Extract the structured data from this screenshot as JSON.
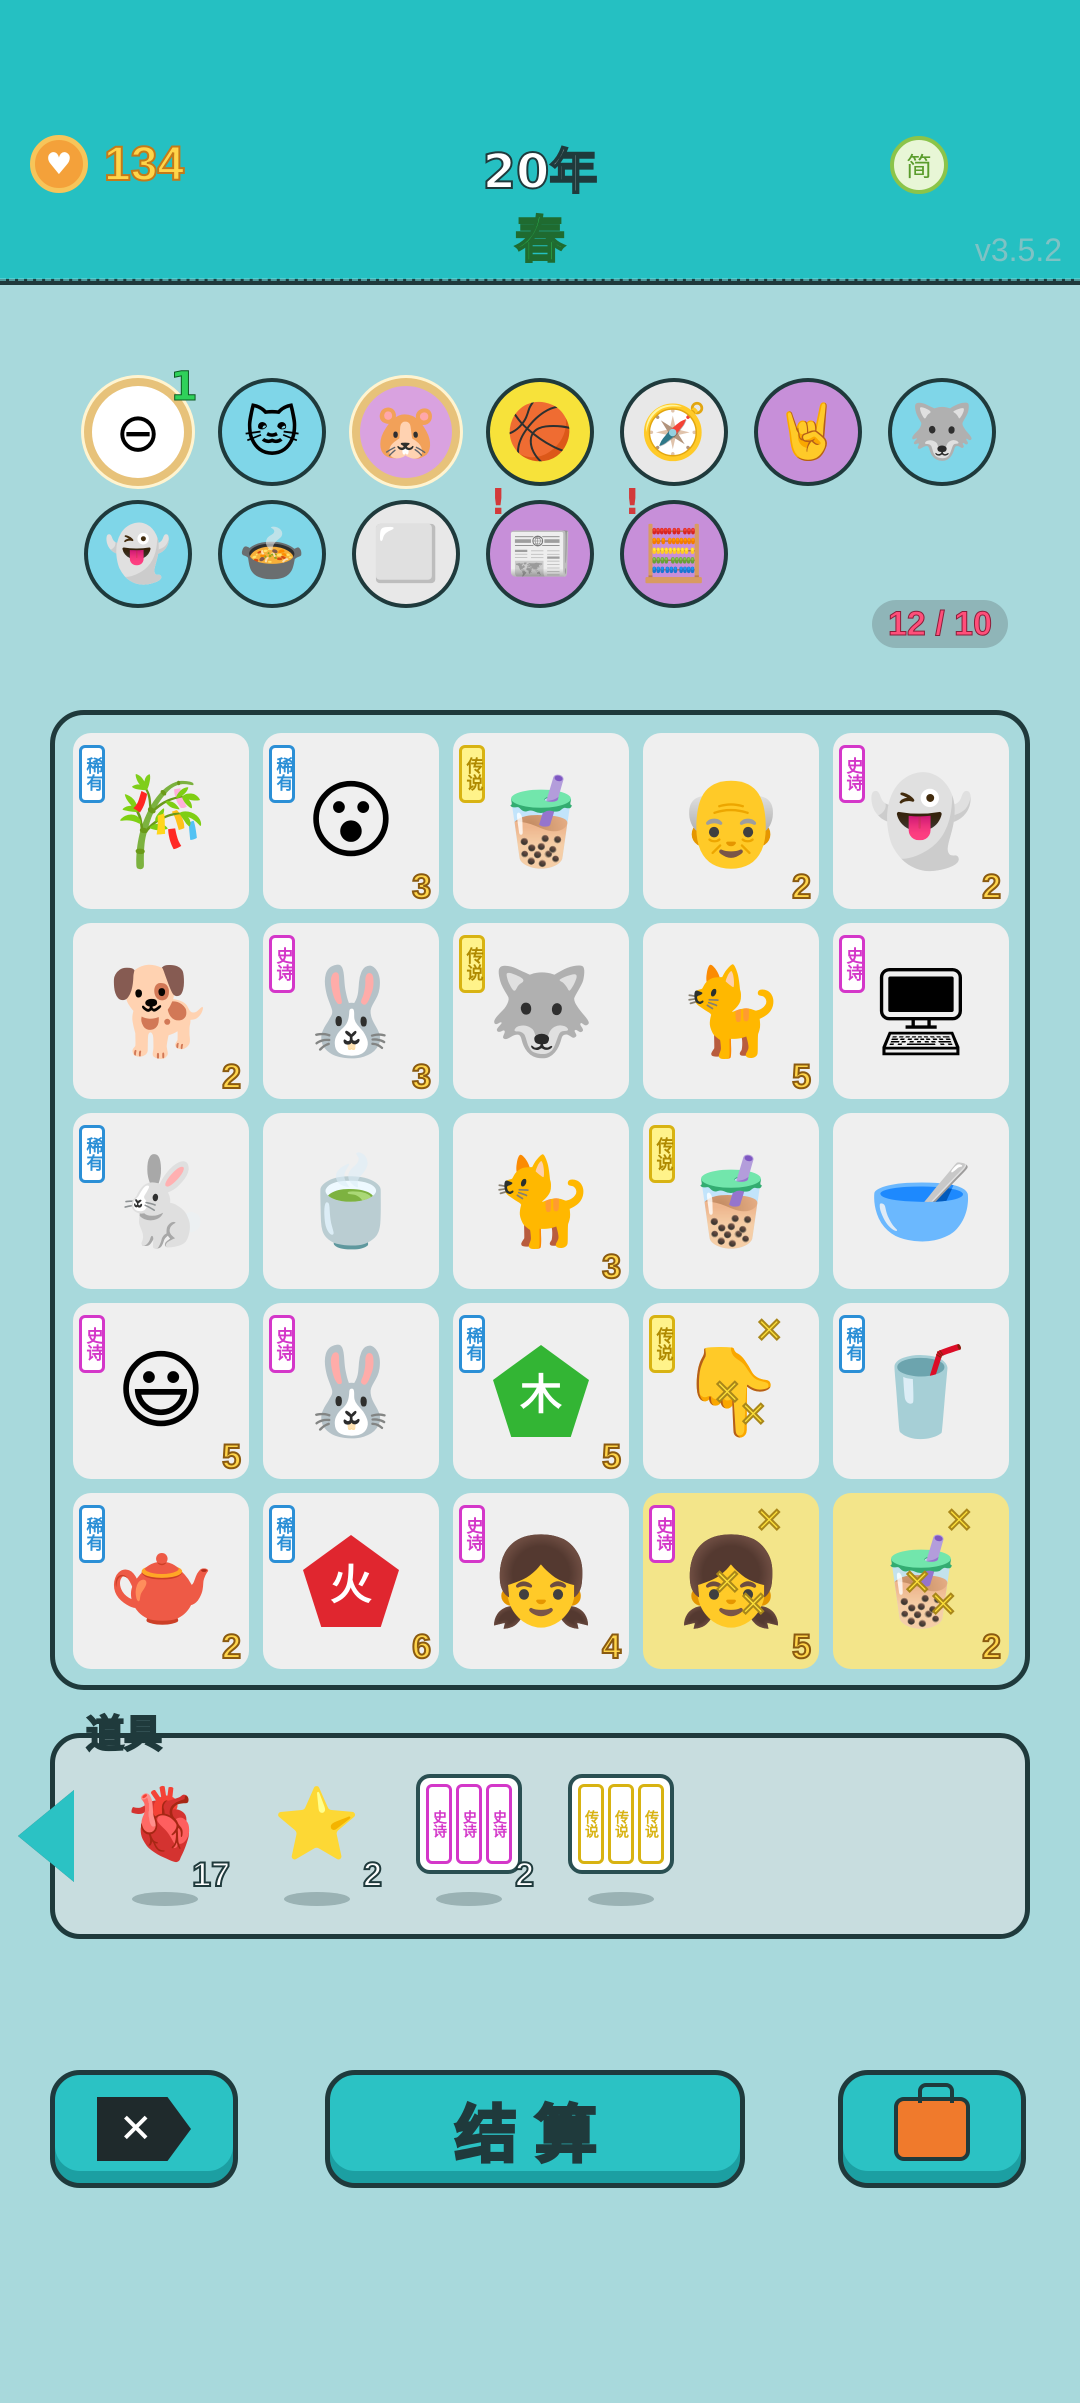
{
  "header": {
    "coins": "134",
    "year": "20年",
    "season": "春",
    "lang_label": "简",
    "version": "v3.5.2"
  },
  "relics": [
    {
      "icon": "⊖",
      "icon_name": "minus-ring-icon",
      "badge": "1",
      "gold": true,
      "bg": "#ffffff"
    },
    {
      "icon": "🐱",
      "icon_name": "cat-in-frame-icon",
      "bg": "#7fd6e8"
    },
    {
      "icon": "🐹",
      "icon_name": "hamsters-icon",
      "gold": true,
      "bg": "#d9a2e0"
    },
    {
      "icon": "🏀",
      "icon_name": "basketballs-icon",
      "bg": "#f7e23a"
    },
    {
      "icon": "🧭",
      "icon_name": "compass-icon",
      "bg": "#e8e8e8"
    },
    {
      "icon": "🤘",
      "icon_name": "rock-hand-icon",
      "bg": "#c78fd9"
    },
    {
      "icon": "🐺",
      "icon_name": "wolf-icon",
      "bg": "#7fd6e8"
    },
    {
      "icon": "👻",
      "icon_name": "ghost-lantern-icon",
      "bg": "#7fd6e8"
    },
    {
      "icon": "🍲",
      "icon_name": "pot-duck-icon",
      "bg": "#7fd6e8"
    },
    {
      "icon": "⬜",
      "icon_name": "sugar-cubes-icon",
      "bg": "#e8e8e8"
    },
    {
      "icon": "📰",
      "icon_name": "time-magazine-icon",
      "alert": "!",
      "bg": "#c78fd9"
    },
    {
      "icon": "🧮",
      "icon_name": "math-face-icon",
      "alert": "!",
      "bg": "#c78fd9"
    }
  ],
  "counter": "12 / 10",
  "board": [
    {
      "icon": "🎋",
      "name": "bamboo",
      "rarity": "稀有",
      "rtype": "rare",
      "count": ""
    },
    {
      "icon": "😮",
      "name": "boy-face",
      "rarity": "稀有",
      "rtype": "rare",
      "count": "3"
    },
    {
      "icon": "🧋",
      "name": "bubble-tea-lid",
      "rarity": "传说",
      "rtype": "legend",
      "count": ""
    },
    {
      "icon": "👴",
      "name": "old-man",
      "rarity": "",
      "rtype": "",
      "count": "2"
    },
    {
      "icon": "👻",
      "name": "ghost",
      "rarity": "史诗",
      "rtype": "epic",
      "count": "2"
    },
    {
      "icon": "🐕",
      "name": "brown-dog",
      "rarity": "",
      "rtype": "",
      "count": "2"
    },
    {
      "icon": "🐰",
      "name": "rabbit-house",
      "rarity": "史诗",
      "rtype": "epic",
      "count": "3"
    },
    {
      "icon": "🐺",
      "name": "husky-king",
      "rarity": "传说",
      "rtype": "legend",
      "count": ""
    },
    {
      "icon": "🐈",
      "name": "yellow-cat",
      "rarity": "",
      "rtype": "",
      "count": "5"
    },
    {
      "icon": "🖥",
      "name": "graphics-card",
      "rarity": "史诗",
      "rtype": "epic",
      "count": ""
    },
    {
      "icon": "🐇",
      "name": "rabbit",
      "rarity": "稀有",
      "rtype": "rare",
      "count": ""
    },
    {
      "icon": "🍵",
      "name": "tea-bag",
      "rarity": "",
      "rtype": "",
      "count": ""
    },
    {
      "icon": "🐈",
      "name": "yellow-cat",
      "rarity": "",
      "rtype": "",
      "count": "3"
    },
    {
      "icon": "🧋",
      "name": "bubble-tea-lid",
      "rarity": "传说",
      "rtype": "legend",
      "count": ""
    },
    {
      "icon": "🥣",
      "name": "tea-bowl",
      "rarity": "",
      "rtype": "",
      "count": ""
    },
    {
      "icon": "😃",
      "name": "yellow-face",
      "rarity": "史诗",
      "rtype": "epic",
      "count": "5"
    },
    {
      "icon": "🐰",
      "name": "rabbit-house",
      "rarity": "史诗",
      "rtype": "epic",
      "count": ""
    },
    {
      "icon": "🟢",
      "name": "wood-element",
      "rarity": "稀有",
      "rtype": "rare",
      "count": "5",
      "glyph": "木"
    },
    {
      "icon": "👇",
      "name": "yellow-hand",
      "rarity": "传说",
      "rtype": "legend",
      "count": "",
      "x": true
    },
    {
      "icon": "🥤",
      "name": "milk-tea-cup",
      "rarity": "稀有",
      "rtype": "rare",
      "count": ""
    },
    {
      "icon": "🫖",
      "name": "teapot",
      "rarity": "稀有",
      "rtype": "rare",
      "count": "2"
    },
    {
      "icon": "🔴",
      "name": "fire-element",
      "rarity": "稀有",
      "rtype": "rare",
      "count": "6",
      "glyph": "火"
    },
    {
      "icon": "👧",
      "name": "heart-girl",
      "rarity": "史诗",
      "rtype": "epic",
      "count": "4"
    },
    {
      "icon": "👧",
      "name": "heart-girl-active",
      "rarity": "史诗",
      "rtype": "epic",
      "count": "5",
      "hl": true,
      "x": true
    },
    {
      "icon": "🧋",
      "name": "bubble-tea-active",
      "rarity": "",
      "rtype": "",
      "count": "2",
      "hl": true,
      "x": true
    }
  ],
  "items_title": "道具",
  "items": [
    {
      "icon": "🫀",
      "icon_name": "liver-icon",
      "count": "17"
    },
    {
      "icon": "⭐",
      "icon_name": "star-icon",
      "count": "2"
    },
    {
      "icon": "scroll-epic",
      "icon_name": "epic-scrolls-icon",
      "count": "2",
      "scroll_label": "史诗",
      "scroll_color": "#d437c9"
    },
    {
      "icon": "scroll-legend",
      "icon_name": "legend-scrolls-icon",
      "count": "",
      "scroll_label": "传说",
      "scroll_color": "#d8b312"
    }
  ],
  "buttons": {
    "exit_label": "✕",
    "settle_label": "结算",
    "bag_label": ""
  }
}
